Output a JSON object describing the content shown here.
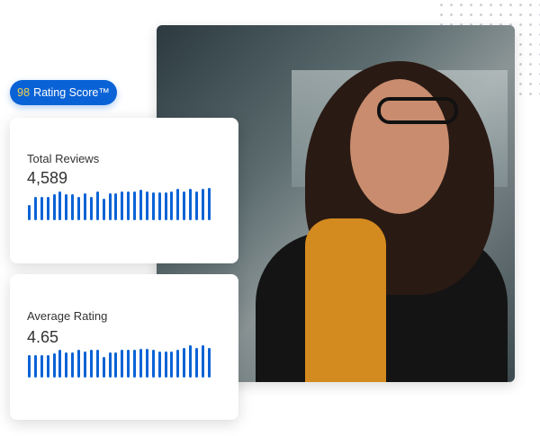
{
  "badge": {
    "score": "98",
    "label": "Rating Score™"
  },
  "cards": [
    {
      "label": "Total Reviews",
      "value": "4,589",
      "bars": [
        17,
        25,
        25,
        25,
        28,
        31,
        28,
        28,
        25,
        29,
        25,
        31,
        23,
        29,
        29,
        31,
        31,
        31,
        33,
        31,
        30,
        30,
        30,
        31,
        34,
        31,
        34,
        31,
        34,
        35
      ]
    },
    {
      "label": "Average Rating",
      "value": "4.65",
      "bars": [
        26,
        26,
        26,
        26,
        28,
        32,
        29,
        29,
        32,
        30,
        32,
        32,
        24,
        29,
        29,
        32,
        32,
        32,
        33,
        33,
        32,
        30,
        30,
        30,
        32,
        34,
        37,
        34,
        37,
        34
      ]
    }
  ],
  "colors": {
    "accent": "#0a63d6",
    "score": "#f2d04a"
  }
}
